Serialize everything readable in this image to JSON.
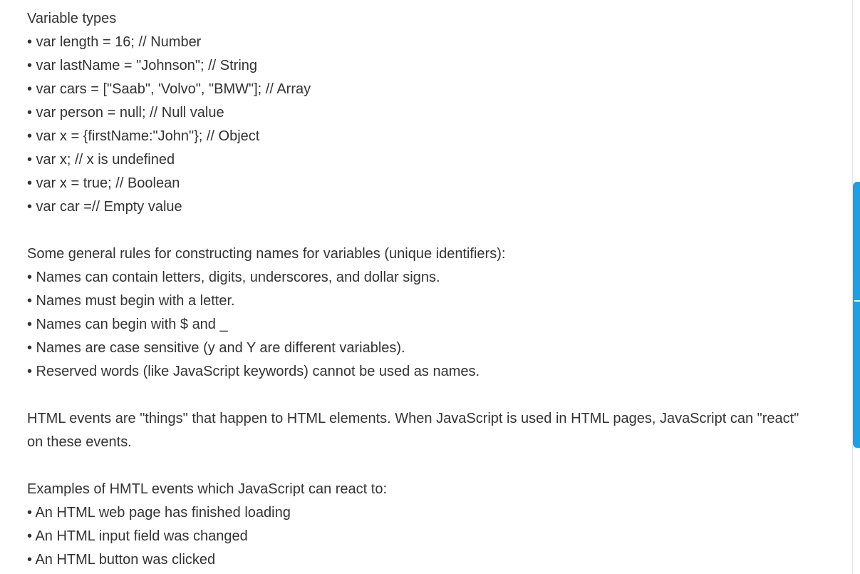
{
  "section_variable_types": {
    "heading": "Variable types",
    "items": [
      "• var length = 16; // Number",
      "• var lastName = \"Johnson\"; // String",
      "• var cars = [\"Saab\", 'Volvo\", \"BMW\"]; // Array",
      "• var person = null; // Null value",
      "• var x = {firstName:\"John\"}; // Object",
      "• var x; // x is undefined",
      "• var x = true; // Boolean",
      "• var car =// Empty value"
    ]
  },
  "section_naming_rules": {
    "heading": "Some general rules for constructing names for variables (unique identifiers):",
    "items": [
      "• Names can contain letters, digits, underscores, and dollar signs.",
      "• Names must begin with a letter.",
      "• Names can begin with $ and _",
      "• Names are case sensitive (y and Y are different variables).",
      "• Reserved words (like JavaScript keywords) cannot be used as names."
    ]
  },
  "section_html_events": {
    "paragraph": "HTML events are \"things\" that happen to HTML elements. When JavaScript is used in HTML pages, JavaScript can \"react\" on these events."
  },
  "section_event_examples": {
    "heading": "Examples of HMTL events which JavaScript can react to:",
    "items": [
      "• An HTML web page has finished loading",
      "• An HTML input field was changed",
      "• An HTML button was clicked"
    ]
  },
  "colors": {
    "text": "#333333",
    "scrollbar_thumb": "#1aa1e6",
    "background": "#ffffff"
  }
}
